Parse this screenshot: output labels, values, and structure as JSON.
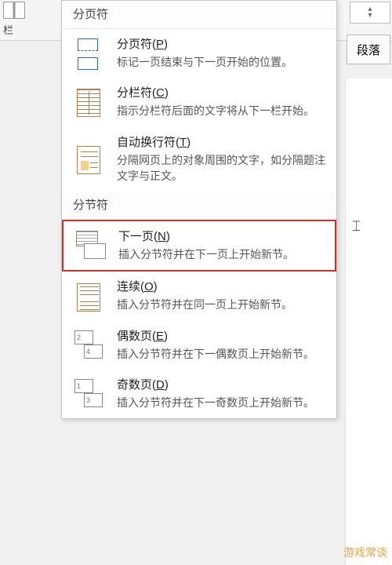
{
  "ribbon": {
    "columns_label": "栏",
    "paragraph_button": "段落"
  },
  "menu": {
    "section_page_breaks": "分页符",
    "section_section_breaks": "分节符",
    "items": [
      {
        "title_pre": "分页符(",
        "key": "P",
        "title_post": ")",
        "desc": "标记一页结束与下一页开始的位置。"
      },
      {
        "title_pre": "分栏符(",
        "key": "C",
        "title_post": ")",
        "desc": "指示分栏符后面的文字将从下一栏开始。"
      },
      {
        "title_pre": "自动换行符(",
        "key": "T",
        "title_post": ")",
        "desc": "分隔网页上的对象周围的文字，如分隔题注文字与正文。"
      },
      {
        "title_pre": "下一页(",
        "key": "N",
        "title_post": ")",
        "desc": "插入分节符并在下一页上开始新节。"
      },
      {
        "title_pre": "连续(",
        "key": "O",
        "title_post": ")",
        "desc": "插入分节符并在同一页上开始新节。"
      },
      {
        "title_pre": "偶数页(",
        "key": "E",
        "title_post": ")",
        "desc": "插入分节符并在下一偶数页上开始新节。"
      },
      {
        "title_pre": "奇数页(",
        "key": "D",
        "title_post": ")",
        "desc": "插入分节符并在下一奇数页上开始新节。"
      }
    ],
    "even_icon_labels": {
      "a": "2",
      "b": "4"
    },
    "odd_icon_labels": {
      "a": "1",
      "b": "3"
    }
  },
  "watermark": "游戏常谈"
}
